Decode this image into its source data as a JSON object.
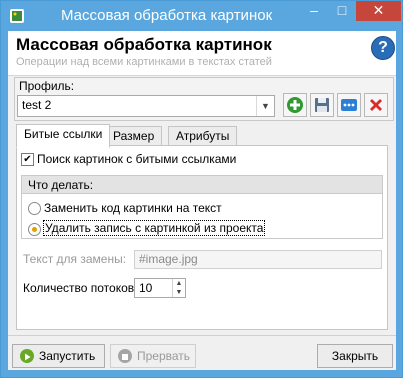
{
  "window": {
    "title": "Массовая обработка картинок",
    "minimize_glyph": "–",
    "maximize_glyph": "□",
    "close_glyph": "✕"
  },
  "header": {
    "title": "Массовая обработка картинок",
    "subtitle": "Операции над всеми картинками в текстах статей",
    "help_glyph": "?"
  },
  "profile": {
    "label": "Профиль:",
    "value": "test 2"
  },
  "tabs": [
    {
      "label": "Битые ссылки",
      "active": true
    },
    {
      "label": "Размер",
      "active": false
    },
    {
      "label": "Атрибуты",
      "active": false
    }
  ],
  "panel": {
    "search_broken_label": "Поиск картинок с битыми ссылками",
    "search_broken_checked": true,
    "what_to_do_label": "Что делать:",
    "option_replace_label": "Заменить код картинки на текст",
    "option_delete_label": "Удалить запись с картинкой из проекта",
    "selected_option": "delete",
    "replace_text_label": "Текст для замены:",
    "replace_text_value": "#image.jpg",
    "threads_label": "Количество потоков:",
    "threads_value": "10"
  },
  "buttons": {
    "run": "Запустить",
    "stop": "Прервать",
    "close": "Закрыть"
  },
  "colors": {
    "titlebar": "#5aa7df",
    "close_button": "#c7463b",
    "add_icon": "#2f9a2f",
    "delete_icon": "#d82b2b",
    "more_icon": "#2b7fd6",
    "help_icon": "#2b6cb6"
  }
}
